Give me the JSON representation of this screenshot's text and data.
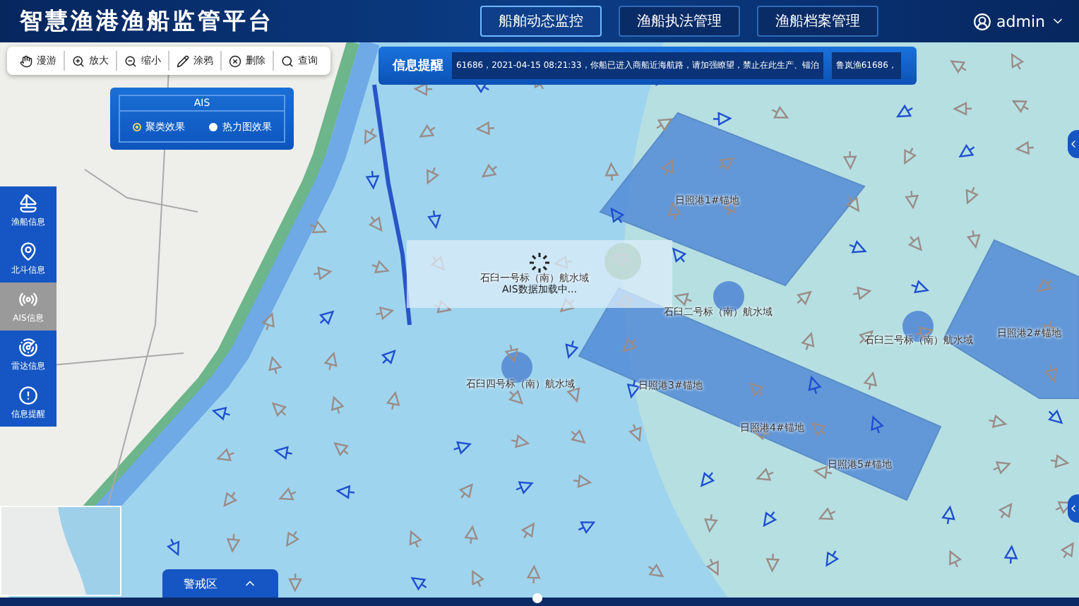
{
  "header": {
    "title": "智慧渔港渔船监管平台",
    "nav": [
      {
        "label": "船舶动态监控",
        "selected": true
      },
      {
        "label": "渔船执法管理",
        "selected": false
      },
      {
        "label": "渔船档案管理",
        "selected": false
      }
    ],
    "user": "admin"
  },
  "toolbar": [
    {
      "kind": "pan",
      "label": "漫游"
    },
    {
      "kind": "zoom-in",
      "label": "放大"
    },
    {
      "kind": "zoom-out",
      "label": "缩小"
    },
    {
      "kind": "draw",
      "label": "涂鸦"
    },
    {
      "kind": "delete",
      "label": "删除"
    },
    {
      "kind": "search",
      "label": "查询"
    }
  ],
  "notice": {
    "title": "信息提醒",
    "messages": [
      "61686，2021-04-15 08:21:33，你船已进入商船近海航路，请加强瞭望，禁止在此生产、锚泊",
      "鲁岚渔61686，"
    ]
  },
  "ais_panel": {
    "title": "AIS",
    "options": [
      {
        "label": "聚类效果",
        "selected": true
      },
      {
        "label": "热力图效果",
        "selected": false
      }
    ]
  },
  "sidebar": [
    {
      "kind": "boat",
      "label": "渔船信息",
      "selected": false
    },
    {
      "kind": "pin",
      "label": "北斗信息",
      "selected": false
    },
    {
      "kind": "ais",
      "label": "AIS信息",
      "selected": true
    },
    {
      "kind": "radar",
      "label": "雷达信息",
      "selected": false
    },
    {
      "kind": "alert",
      "label": "信息提醒",
      "selected": false
    }
  ],
  "loading": {
    "text": "AIS数据加载中..."
  },
  "map_labels": [
    {
      "label": "日照港1#锚地"
    },
    {
      "label": "石臼一号标（南）航水域"
    },
    {
      "label": "石臼二号标（南）航水域"
    },
    {
      "label": "石臼三号标（南）航水域"
    },
    {
      "label": "日照港2#锚地"
    },
    {
      "label": "石臼四号标（南）航水域"
    },
    {
      "label": "日照港3#锚地"
    },
    {
      "label": "日照港4#锚地"
    },
    {
      "label": "日照港5#锚地"
    }
  ],
  "bottom_tab": {
    "label": "警戒区"
  }
}
